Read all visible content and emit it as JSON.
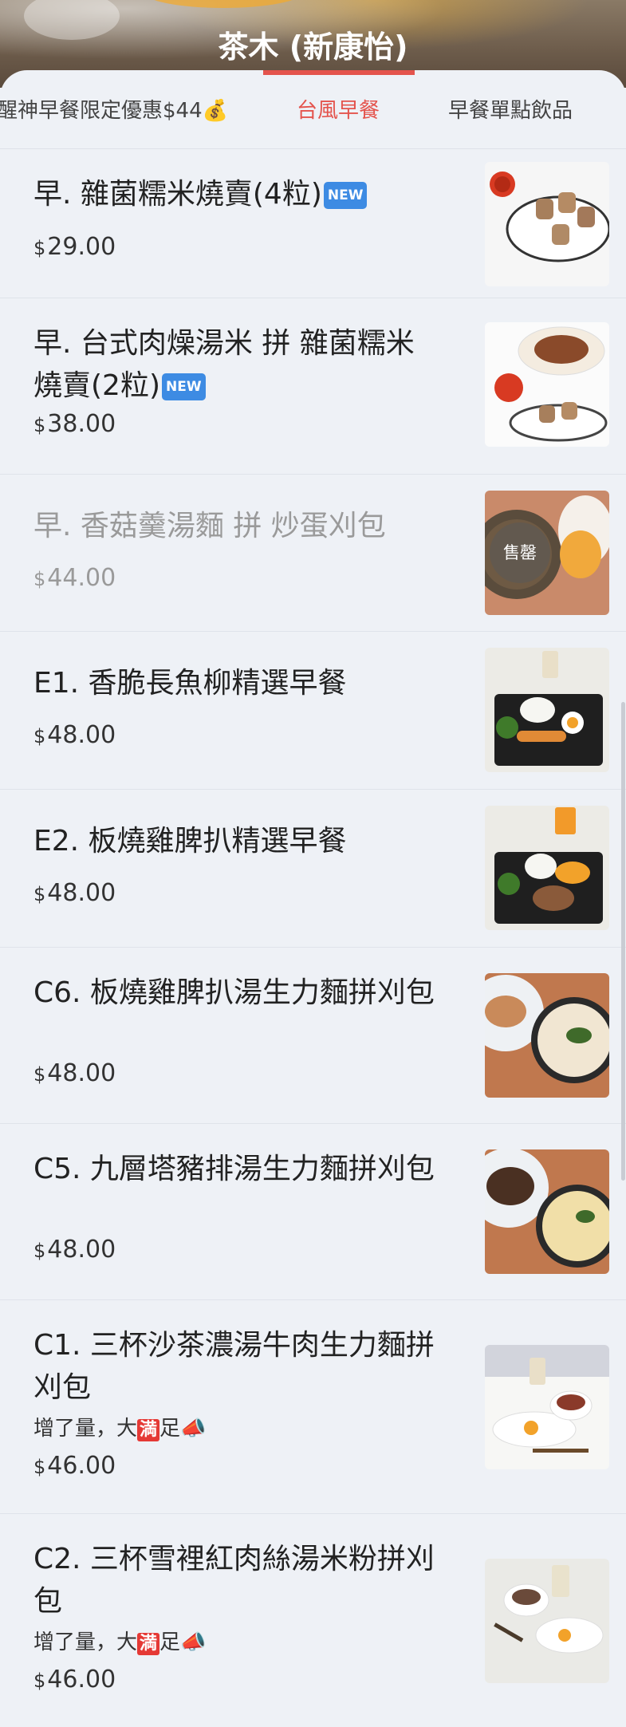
{
  "header": {
    "title": "茶木 (新康怡)"
  },
  "tabs": [
    {
      "label": "醒神早餐限定優惠$44💰",
      "active": false
    },
    {
      "label": "台風早餐",
      "active": true
    },
    {
      "label": "早餐單點飲品",
      "active": false
    }
  ],
  "colors": {
    "accent": "#e4544d",
    "new_badge": "#3d8be3",
    "background": "#eef1f6"
  },
  "currency": "$",
  "items": [
    {
      "name": "早. 雜菌糯米燒賣(4粒)",
      "new_badge": "NEW",
      "price": "29.00",
      "promo": "",
      "sold_out": false
    },
    {
      "name": "早. 台式肉燥湯米 拼 雜菌糯米燒賣(2粒)",
      "new_badge": "NEW",
      "price": "38.00",
      "promo": "",
      "sold_out": false
    },
    {
      "name": "早. 香菇羹湯麵 拼 炒蛋刈包",
      "new_badge": "",
      "price": "44.00",
      "promo": "",
      "sold_out": true,
      "sold_out_label": "售罄"
    },
    {
      "name": "E1. 香脆長魚柳精選早餐",
      "new_badge": "",
      "price": "48.00",
      "promo": "",
      "sold_out": false
    },
    {
      "name": "E2. 板燒雞脾扒精選早餐",
      "new_badge": "",
      "price": "48.00",
      "promo": "",
      "sold_out": false
    },
    {
      "name": "C6. 板燒雞脾扒湯生力麵拼刈包",
      "new_badge": "",
      "price": "48.00",
      "promo": "",
      "sold_out": false
    },
    {
      "name": "C5. 九層塔豬排湯生力麵拼刈包",
      "new_badge": "",
      "price": "48.00",
      "promo": "",
      "sold_out": false
    },
    {
      "name": "C1. 三杯沙茶濃湯牛肉生力麵拼刈包",
      "new_badge": "",
      "price": "46.00",
      "promo_pre": "增了量，大",
      "promo_mark": "満",
      "promo_post": "足📣",
      "sold_out": false
    },
    {
      "name": "C2. 三杯雪裡紅肉絲湯米粉拼刈包",
      "new_badge": "",
      "price": "46.00",
      "promo_pre": "增了量，大",
      "promo_mark": "満",
      "promo_post": "足📣",
      "sold_out": false
    }
  ]
}
